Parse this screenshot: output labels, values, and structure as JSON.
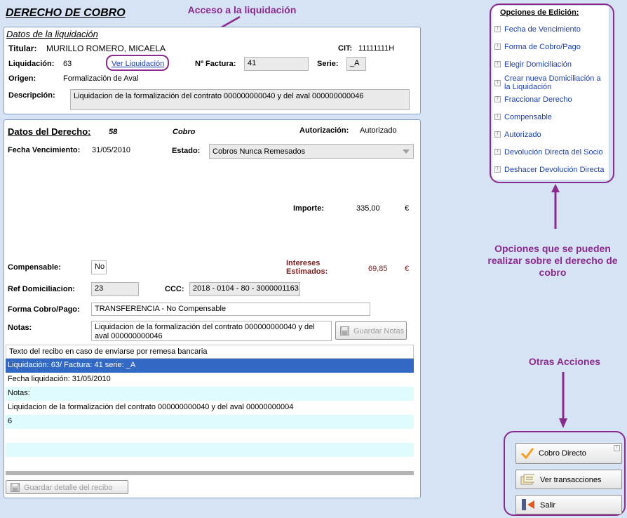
{
  "page_title": "DERECHO DE COBRO",
  "annotations": {
    "liquidacion_access": "Acceso a la liquidación",
    "options_note": "Opciones que se pueden realizar sobre el derecho de cobro",
    "other_actions": "Otras Acciones"
  },
  "liquidacion": {
    "section_title": "Datos de la liquidación",
    "titular_label": "Titular:",
    "titular_value": "MURILLO ROMERO, MICAELA",
    "cit_label": "CIT:",
    "cit_value": "11111111H",
    "liquidacion_label": "Liquidación:",
    "liquidacion_value": "63",
    "ver_liquidacion": "Ver Liquidación",
    "factura_label": "Nº Factura:",
    "factura_value": "41",
    "serie_label": "Serie:",
    "serie_value": "_A",
    "origen_label": "Origen:",
    "origen_value": "Formalización de Aval",
    "descripcion_label": "Descripción:",
    "descripcion_value": "Liquidacion de la formalización del contrato 000000000040 y del aval 000000000046"
  },
  "derecho": {
    "section_title": "Datos del Derecho:",
    "number": "58",
    "cobro": "Cobro",
    "autorizacion_label": "Autorización:",
    "autorizacion_value": "Autorizado",
    "fecha_label": "Fecha Vencimiento:",
    "fecha_value": "31/05/2010",
    "estado_label": "Estado:",
    "estado_value": "Cobros Nunca Remesados",
    "importe_label": "Importe:",
    "importe_value": "335,00",
    "currency": "€",
    "compensable_label": "Compensable:",
    "compensable_value": "No",
    "intereses_label_1": "Intereses",
    "intereses_label_2": "Estimados:",
    "intereses_value": "69,85",
    "ref_label": "Ref Domiciliacion:",
    "ref_value": "23",
    "ccc_label": "CCC:",
    "ccc_value": "2018 - 0104 - 80 - 3000001163",
    "forma_label": "Forma Cobro/Pago:",
    "forma_value": "TRANSFERENCIA - No Compensable",
    "notas_label": "Notas:",
    "notas_value": "Liquidacion de la formalización del contrato 000000000040 y del aval 000000000046",
    "guardar_notas": "Guardar Notas",
    "recibo_header": "Texto del recibo en caso de enviarse por  remesa bancaria",
    "recibo_rows": [
      "Liquidación: 63/ Factura: 41 serie: _A",
      "Fecha liquidación: 31/05/2010",
      "Notas:",
      "Liquidacion de la formalización del contrato 000000000040 y del aval 00000000004",
      "6",
      "",
      "",
      ""
    ],
    "guardar_detalle": "Guardar detalle del recibo"
  },
  "opciones": {
    "title": "Opciones de Edición:",
    "items": [
      "Fecha de Vencimiento",
      "Forma de Cobro/Pago",
      "Elegir Domiciliación",
      "Crear nueva Domiciliación a la Liquidación",
      "Fraccionar Derecho",
      "Compensable",
      "Autorizado",
      "Devolución Directa del Socio",
      "Deshacer Devolución Directa"
    ]
  },
  "acciones": {
    "cobro_directo": "Cobro Directo",
    "ver_transacciones": "Ver transacciones",
    "salir": "Salir"
  },
  "colors": {
    "background": "#d6e3f4",
    "panel_border": "#7fa0c7",
    "annotation": "#8a2a8c",
    "link": "#1e3fa8",
    "selected_row": "#3269c4",
    "alt_row": "#e0fbfb",
    "intereses": "#7a1f1f"
  }
}
